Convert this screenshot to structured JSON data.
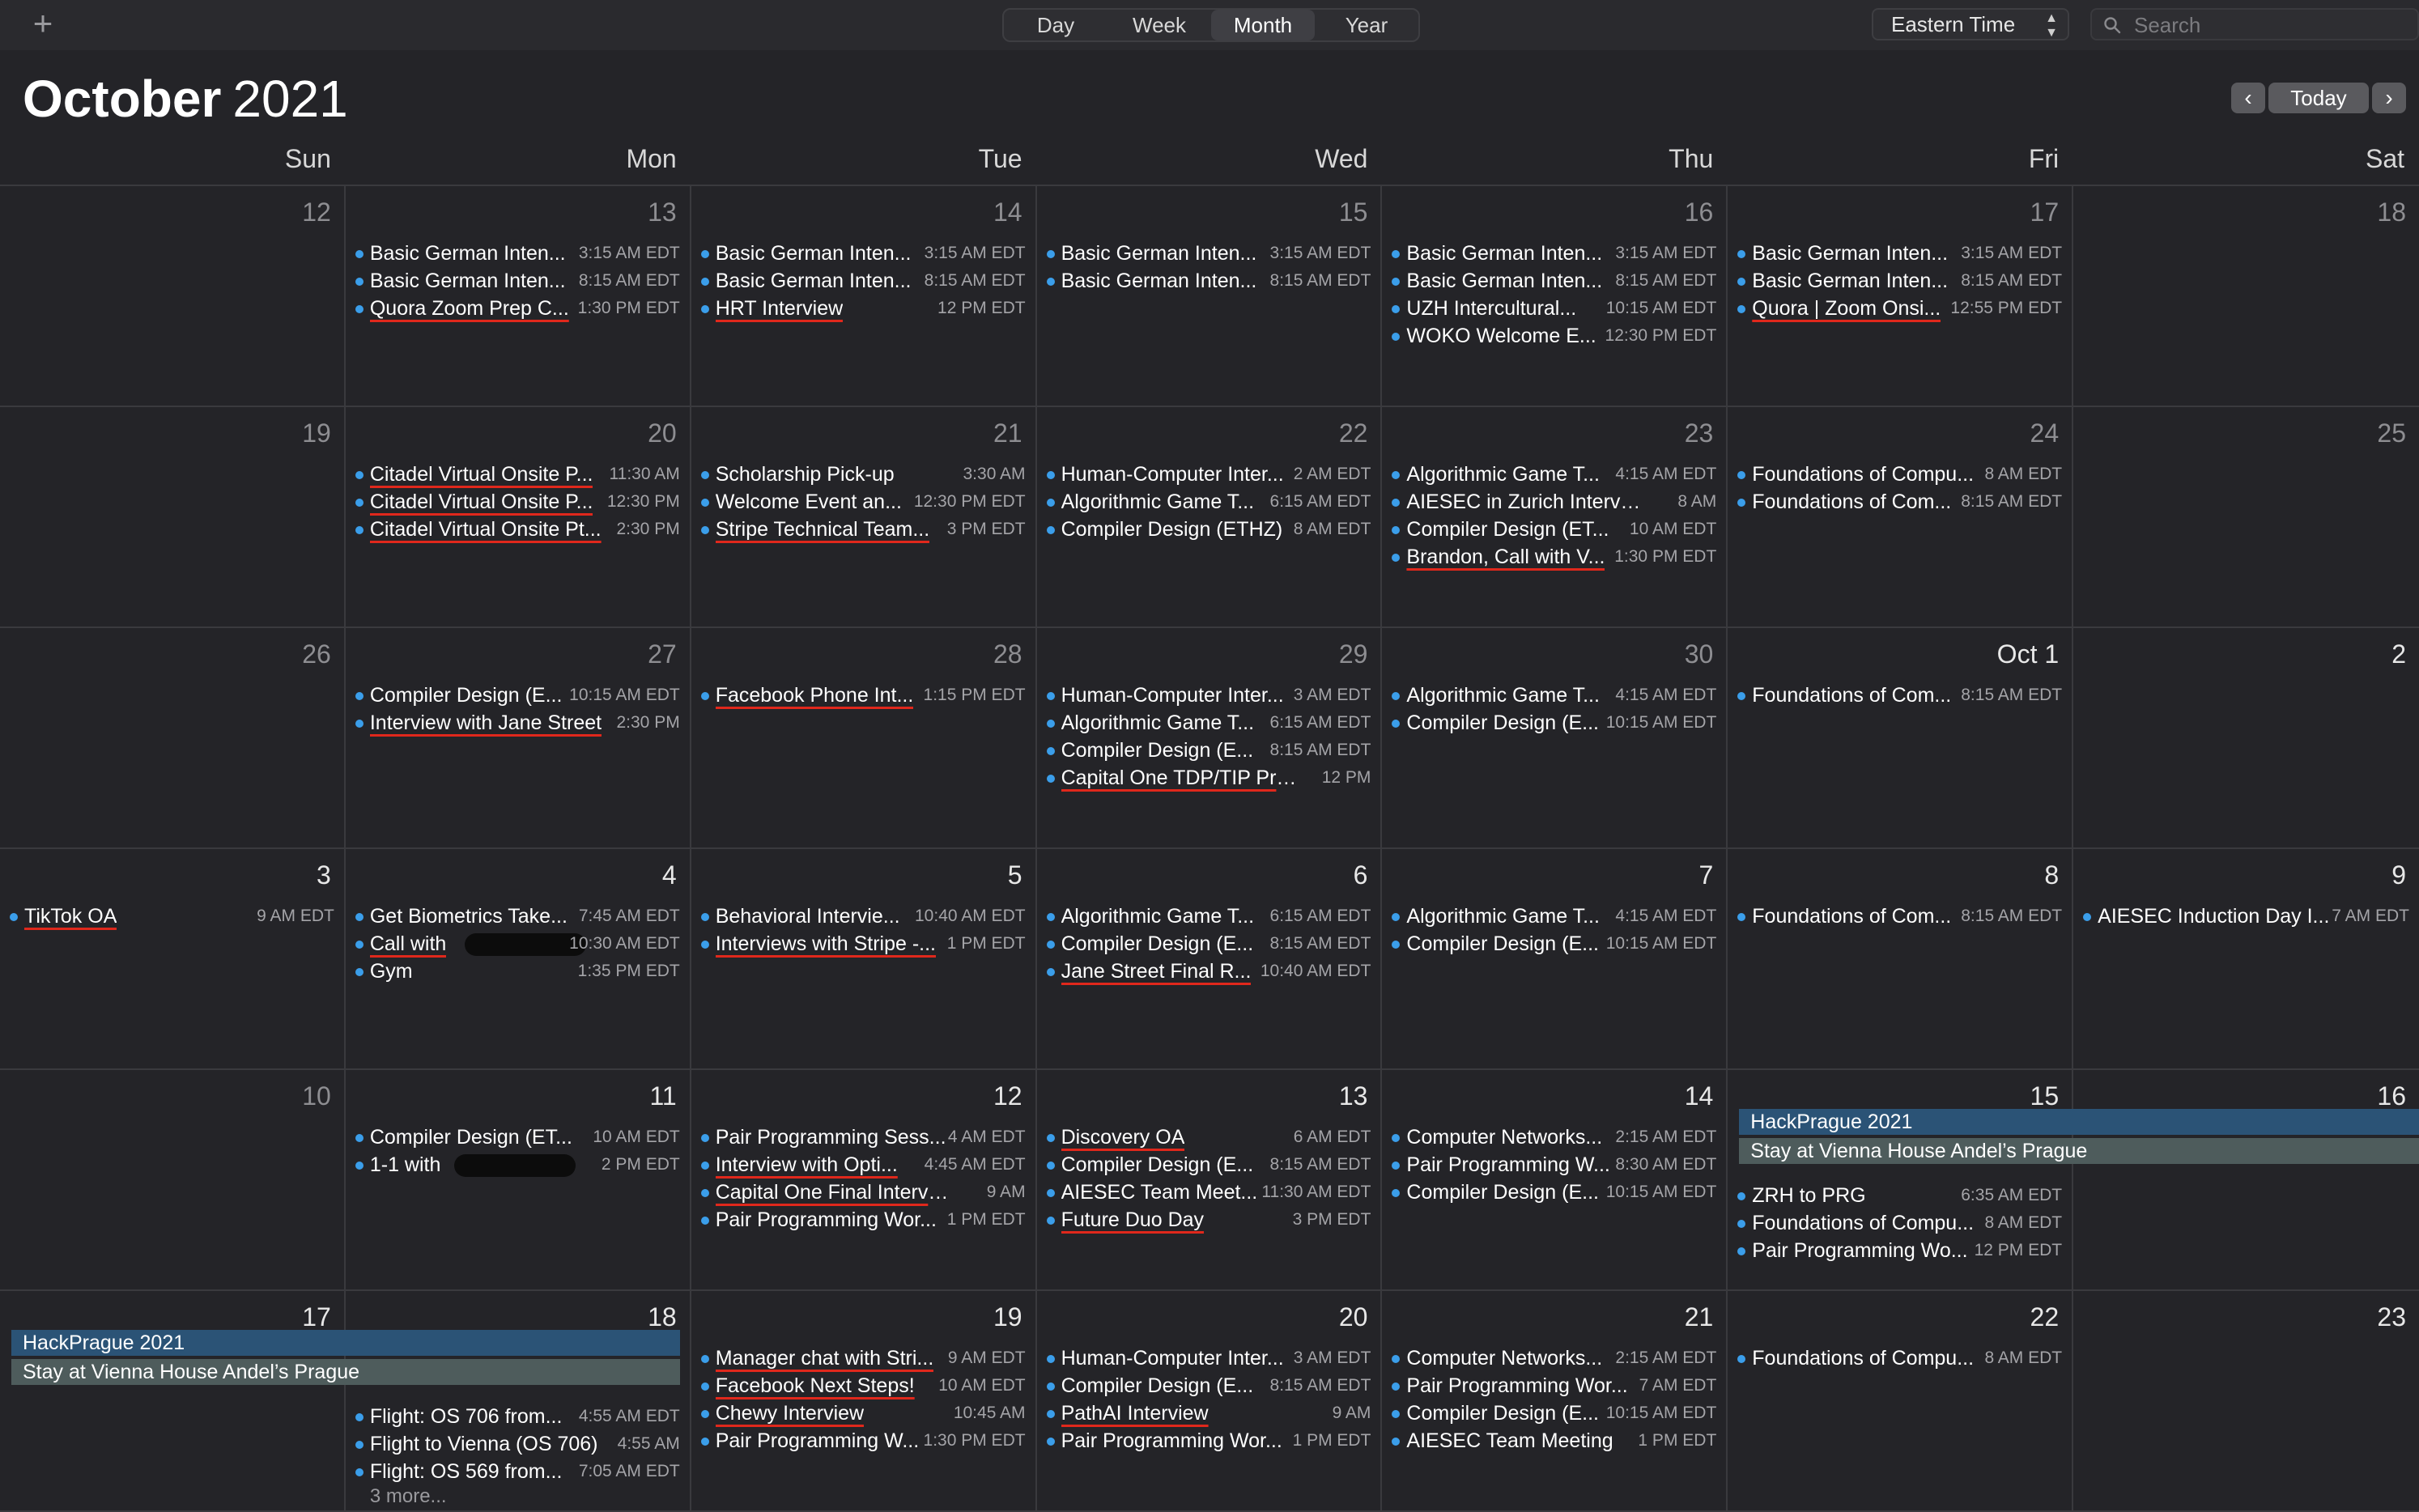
{
  "toolbar": {
    "add_label": "+",
    "views": [
      "Day",
      "Week",
      "Month",
      "Year"
    ],
    "active_view": "Month",
    "timezone": "Eastern Time",
    "search_placeholder": "Search"
  },
  "header": {
    "month": "October",
    "year": "2021",
    "today_label": "Today",
    "prev_icon": "chevron-left-icon",
    "next_icon": "chevron-right-icon"
  },
  "weekdays": [
    "Sun",
    "Mon",
    "Tue",
    "Wed",
    "Thu",
    "Fri",
    "Sat"
  ],
  "colors": {
    "event_dot": "#3b9eea",
    "underline": "#e0281c",
    "bar_blue": "#2b5376",
    "bar_gray": "#4e5c5c"
  },
  "weeks": [
    [
      {
        "day": "12",
        "events": []
      },
      {
        "day": "13",
        "events": [
          {
            "title": "Basic German Inten...",
            "time": "3:15 AM EDT"
          },
          {
            "title": "Basic German Inten...",
            "time": "8:15 AM EDT"
          },
          {
            "title": "Quora Zoom Prep C...",
            "time": "1:30 PM EDT",
            "underline": true
          }
        ]
      },
      {
        "day": "14",
        "events": [
          {
            "title": "Basic German Inten...",
            "time": "3:15 AM EDT"
          },
          {
            "title": "Basic German Inten...",
            "time": "8:15 AM EDT"
          },
          {
            "title": "HRT Interview",
            "time": "12 PM EDT",
            "underline": true
          }
        ]
      },
      {
        "day": "15",
        "events": [
          {
            "title": "Basic German Inten...",
            "time": "3:15 AM EDT"
          },
          {
            "title": "Basic German Inten...",
            "time": "8:15 AM EDT"
          }
        ]
      },
      {
        "day": "16",
        "events": [
          {
            "title": "Basic German Inten...",
            "time": "3:15 AM EDT"
          },
          {
            "title": "Basic German Inten...",
            "time": "8:15 AM EDT"
          },
          {
            "title": "UZH Intercultural...",
            "time": "10:15 AM EDT"
          },
          {
            "title": "WOKO Welcome E...",
            "time": "12:30 PM EDT"
          }
        ]
      },
      {
        "day": "17",
        "events": [
          {
            "title": "Basic German Inten...",
            "time": "3:15 AM EDT"
          },
          {
            "title": "Basic German Inten...",
            "time": "8:15 AM EDT"
          },
          {
            "title": "Quora | Zoom Onsi...",
            "time": "12:55 PM EDT",
            "underline": true
          }
        ]
      },
      {
        "day": "18",
        "events": []
      }
    ],
    [
      {
        "day": "19",
        "events": []
      },
      {
        "day": "20",
        "events": [
          {
            "title": "Citadel Virtual Onsite P...",
            "time": "11:30 AM",
            "underline": true
          },
          {
            "title": "Citadel Virtual Onsite P...",
            "time": "12:30 PM",
            "underline": true
          },
          {
            "title": "Citadel Virtual Onsite Pt...",
            "time": "2:30 PM",
            "underline": true
          }
        ]
      },
      {
        "day": "21",
        "events": [
          {
            "title": "Scholarship Pick-up",
            "time": "3:30 AM"
          },
          {
            "title": "Welcome Event an...",
            "time": "12:30 PM EDT"
          },
          {
            "title": "Stripe Technical Team...",
            "time": "3 PM EDT",
            "underline": true
          }
        ]
      },
      {
        "day": "22",
        "events": [
          {
            "title": "Human-Computer Inter...",
            "time": "2 AM EDT"
          },
          {
            "title": "Algorithmic Game T...",
            "time": "6:15 AM EDT"
          },
          {
            "title": "Compiler Design (ETHZ)",
            "time": "8 AM EDT"
          }
        ]
      },
      {
        "day": "23",
        "events": [
          {
            "title": "Algorithmic Game T...",
            "time": "4:15 AM EDT"
          },
          {
            "title": "AIESEC in Zurich Interview...",
            "time": "8 AM"
          },
          {
            "title": "Compiler Design (ET...",
            "time": "10 AM EDT"
          },
          {
            "title": "Brandon, Call with V...",
            "time": "1:30 PM EDT",
            "underline": true
          }
        ]
      },
      {
        "day": "24",
        "events": [
          {
            "title": "Foundations of Compu...",
            "time": "8 AM EDT"
          },
          {
            "title": "Foundations of Com...",
            "time": "8:15 AM EDT"
          }
        ]
      },
      {
        "day": "25",
        "events": []
      }
    ],
    [
      {
        "day": "26",
        "events": []
      },
      {
        "day": "27",
        "events": [
          {
            "title": "Compiler Design (E...",
            "time": "10:15 AM EDT"
          },
          {
            "title": "Interview with Jane Street",
            "time": "2:30 PM",
            "underline": true
          }
        ]
      },
      {
        "day": "28",
        "events": [
          {
            "title": "Facebook Phone Int...",
            "time": "1:15 PM EDT",
            "underline": true
          }
        ]
      },
      {
        "day": "29",
        "events": [
          {
            "title": "Human-Computer Inter...",
            "time": "3 AM EDT"
          },
          {
            "title": "Algorithmic Game T...",
            "time": "6:15 AM EDT"
          },
          {
            "title": "Compiler Design (E...",
            "time": "8:15 AM EDT"
          },
          {
            "title": "Capital One TDP/TIP Prep...",
            "time": "12 PM",
            "underline": true
          }
        ]
      },
      {
        "day": "30",
        "events": [
          {
            "title": "Algorithmic Game T...",
            "time": "4:15 AM EDT"
          },
          {
            "title": "Compiler Design (E...",
            "time": "10:15 AM EDT"
          }
        ]
      },
      {
        "day": "Oct 1",
        "current": true,
        "events": [
          {
            "title": "Foundations of Com...",
            "time": "8:15 AM EDT"
          }
        ]
      },
      {
        "day": "2",
        "current": true,
        "events": []
      }
    ],
    [
      {
        "day": "3",
        "current": true,
        "events": [
          {
            "title": "TikTok OA",
            "time": "9 AM EDT",
            "underline": true
          }
        ]
      },
      {
        "day": "4",
        "current": true,
        "events": [
          {
            "title": "Get Biometrics Take...",
            "time": "7:45 AM EDT"
          },
          {
            "title": "Call with",
            "time": "10:30 AM EDT",
            "underline": true,
            "redacted": true
          },
          {
            "title": "Gym",
            "time": "1:35 PM EDT"
          }
        ]
      },
      {
        "day": "5",
        "current": true,
        "events": [
          {
            "title": "Behavioral Intervie...",
            "time": "10:40 AM EDT"
          },
          {
            "title": "Interviews with Stripe -...",
            "time": "1 PM EDT",
            "underline": true
          }
        ]
      },
      {
        "day": "6",
        "current": true,
        "events": [
          {
            "title": "Algorithmic Game T...",
            "time": "6:15 AM EDT"
          },
          {
            "title": "Compiler Design (E...",
            "time": "8:15 AM EDT"
          },
          {
            "title": "Jane Street Final R...",
            "time": "10:40 AM EDT",
            "underline": true
          }
        ]
      },
      {
        "day": "7",
        "current": true,
        "events": [
          {
            "title": "Algorithmic Game T...",
            "time": "4:15 AM EDT"
          },
          {
            "title": "Compiler Design (E...",
            "time": "10:15 AM EDT"
          }
        ]
      },
      {
        "day": "8",
        "current": true,
        "events": [
          {
            "title": "Foundations of Com...",
            "time": "8:15 AM EDT"
          }
        ]
      },
      {
        "day": "9",
        "current": true,
        "events": [
          {
            "title": "AIESEC Induction Day I...",
            "time": "7 AM EDT"
          }
        ]
      }
    ],
    [
      {
        "day": "10",
        "events": []
      },
      {
        "day": "11",
        "current": true,
        "events": [
          {
            "title": "Compiler Design (ET...",
            "time": "10 AM EDT"
          },
          {
            "title": "1-1 with",
            "time": "2 PM EDT",
            "redacted": true
          }
        ]
      },
      {
        "day": "12",
        "current": true,
        "events": [
          {
            "title": "Pair Programming Sess...",
            "time": "4 AM EDT"
          },
          {
            "title": "Interview with Opti...",
            "time": "4:45 AM EDT",
            "underline": true
          },
          {
            "title": "Capital One Final Interview",
            "time": "9 AM",
            "underline": true
          },
          {
            "title": "Pair Programming Wor...",
            "time": "1 PM EDT"
          }
        ]
      },
      {
        "day": "13",
        "current": true,
        "events": [
          {
            "title": "Discovery OA",
            "time": "6 AM EDT",
            "underline": true
          },
          {
            "title": "Compiler Design (E...",
            "time": "8:15 AM EDT"
          },
          {
            "title": "AIESEC Team Meet...",
            "time": "11:30 AM EDT"
          },
          {
            "title": "Future Duo Day",
            "time": "3 PM EDT",
            "underline": true
          }
        ]
      },
      {
        "day": "14",
        "current": true,
        "events": [
          {
            "title": "Computer Networks...",
            "time": "2:15 AM EDT"
          },
          {
            "title": "Pair Programming W...",
            "time": "8:30 AM EDT"
          },
          {
            "title": "Compiler Design (E...",
            "time": "10:15 AM EDT"
          }
        ]
      },
      {
        "day": "15",
        "current": true,
        "bar_rows": 2,
        "events": [
          {
            "title": "ZRH to PRG",
            "time": "6:35 AM EDT"
          },
          {
            "title": "Foundations of Compu...",
            "time": "8 AM EDT"
          },
          {
            "title": "Pair Programming Wo...",
            "time": "12 PM EDT"
          }
        ]
      },
      {
        "day": "16",
        "current": true,
        "bar_rows": 2,
        "events": []
      }
    ],
    [
      {
        "day": "17",
        "current": true,
        "bar_rows": 2,
        "events": []
      },
      {
        "day": "18",
        "current": true,
        "bar_rows": 2,
        "events": [
          {
            "title": "Flight: OS 706 from...",
            "time": "4:55 AM EDT"
          },
          {
            "title": "Flight to Vienna (OS 706)",
            "time": "4:55 AM"
          },
          {
            "title": "Flight: OS 569 from...",
            "time": "7:05 AM EDT"
          }
        ],
        "more": "3 more..."
      },
      {
        "day": "19",
        "current": true,
        "events": [
          {
            "title": "Manager chat with Stri...",
            "time": "9 AM EDT",
            "underline": true
          },
          {
            "title": "Facebook Next Steps!",
            "time": "10 AM EDT",
            "underline": true
          },
          {
            "title": "Chewy Interview",
            "time": "10:45 AM",
            "underline": true
          },
          {
            "title": "Pair Programming W...",
            "time": "1:30 PM EDT"
          }
        ]
      },
      {
        "day": "20",
        "current": true,
        "events": [
          {
            "title": "Human-Computer Inter...",
            "time": "3 AM EDT"
          },
          {
            "title": "Compiler Design (E...",
            "time": "8:15 AM EDT"
          },
          {
            "title": "PathAI Interview",
            "time": "9 AM",
            "underline": true
          },
          {
            "title": "Pair Programming Wor...",
            "time": "1 PM EDT"
          }
        ]
      },
      {
        "day": "21",
        "current": true,
        "events": [
          {
            "title": "Computer Networks...",
            "time": "2:15 AM EDT"
          },
          {
            "title": "Pair Programming Wor...",
            "time": "7 AM EDT"
          },
          {
            "title": "Compiler Design (E...",
            "time": "10:15 AM EDT"
          },
          {
            "title": "AIESEC Team Meeting",
            "time": "1 PM EDT"
          }
        ]
      },
      {
        "day": "22",
        "current": true,
        "events": [
          {
            "title": "Foundations of Compu...",
            "time": "8 AM EDT"
          }
        ]
      },
      {
        "day": "23",
        "current": true,
        "events": []
      }
    ]
  ],
  "allday_bars": [
    {
      "row": 4,
      "startCol": 5,
      "endCol": 6,
      "line": 0,
      "title": "HackPrague 2021",
      "color": "blue"
    },
    {
      "row": 4,
      "startCol": 5,
      "endCol": 6,
      "line": 1,
      "title": "Stay at Vienna House Andel’s Prague",
      "color": "gray"
    },
    {
      "row": 5,
      "startCol": 0,
      "endCol": 1,
      "line": 0,
      "title": "HackPrague 2021",
      "color": "blue"
    },
    {
      "row": 5,
      "startCol": 0,
      "endCol": 1,
      "line": 1,
      "title": "Stay at Vienna House Andel’s Prague",
      "color": "gray"
    }
  ]
}
